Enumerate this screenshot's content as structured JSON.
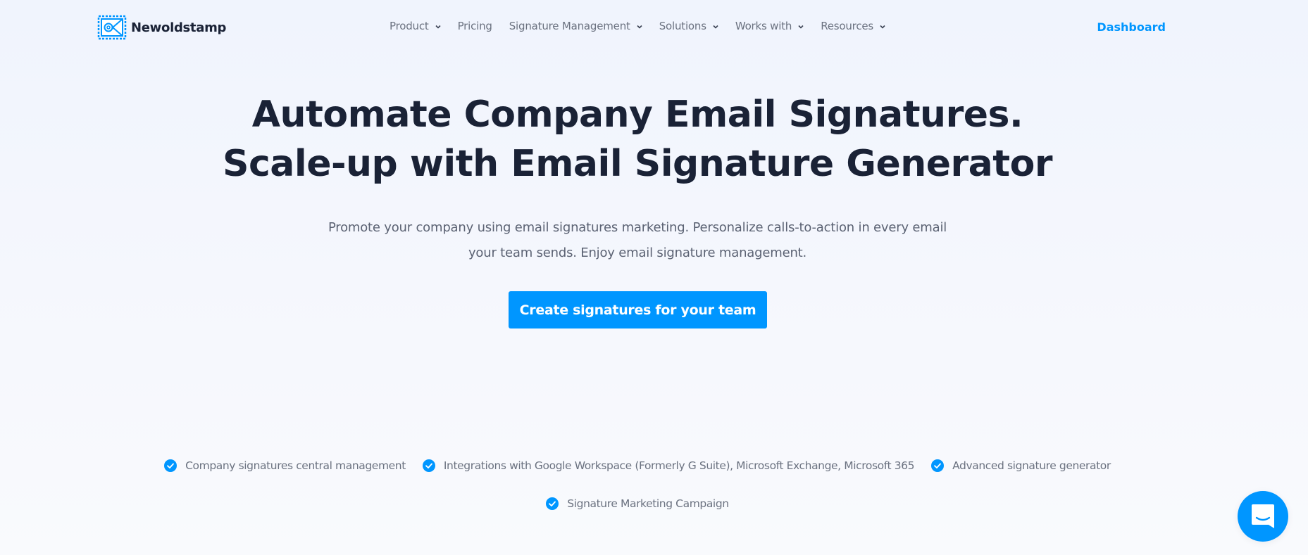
{
  "header": {
    "logo_text": "Newoldstamp",
    "nav": [
      {
        "label": "Product",
        "has_dropdown": true
      },
      {
        "label": "Pricing",
        "has_dropdown": false
      },
      {
        "label": "Signature Management",
        "has_dropdown": true
      },
      {
        "label": "Solutions",
        "has_dropdown": true
      },
      {
        "label": "Works with",
        "has_dropdown": true
      },
      {
        "label": "Resources",
        "has_dropdown": true
      }
    ],
    "dashboard_label": "Dashboard"
  },
  "hero": {
    "title_line1": "Automate Company Email Signatures.",
    "title_line2": "Scale-up with Email Signature Generator",
    "subtitle_line1": "Promote your company using email signatures marketing. Personalize calls-to-action in every email",
    "subtitle_line2": "your team sends. Enjoy email signature management.",
    "cta_label": "Create signatures for your team"
  },
  "features": [
    {
      "label": "Company signatures central management",
      "icon": "check-circle-icon"
    },
    {
      "label": "Integrations with Google Workspace (Formerly G Suite), Microsoft Exchange, Microsoft 365",
      "icon": "check-circle-icon"
    },
    {
      "label": "Advanced signature generator",
      "icon": "check-circle-icon"
    },
    {
      "label": "Signature Marketing Campaign",
      "icon": "check-circle-icon"
    }
  ],
  "chat_widget": {
    "icon": "chat-bubble-icon"
  },
  "colors": {
    "accent": "#0096ff",
    "heading": "#1a2236",
    "body_text": "#5b6273",
    "nav_text": "#6b7280",
    "background": "#f3f6fd"
  }
}
